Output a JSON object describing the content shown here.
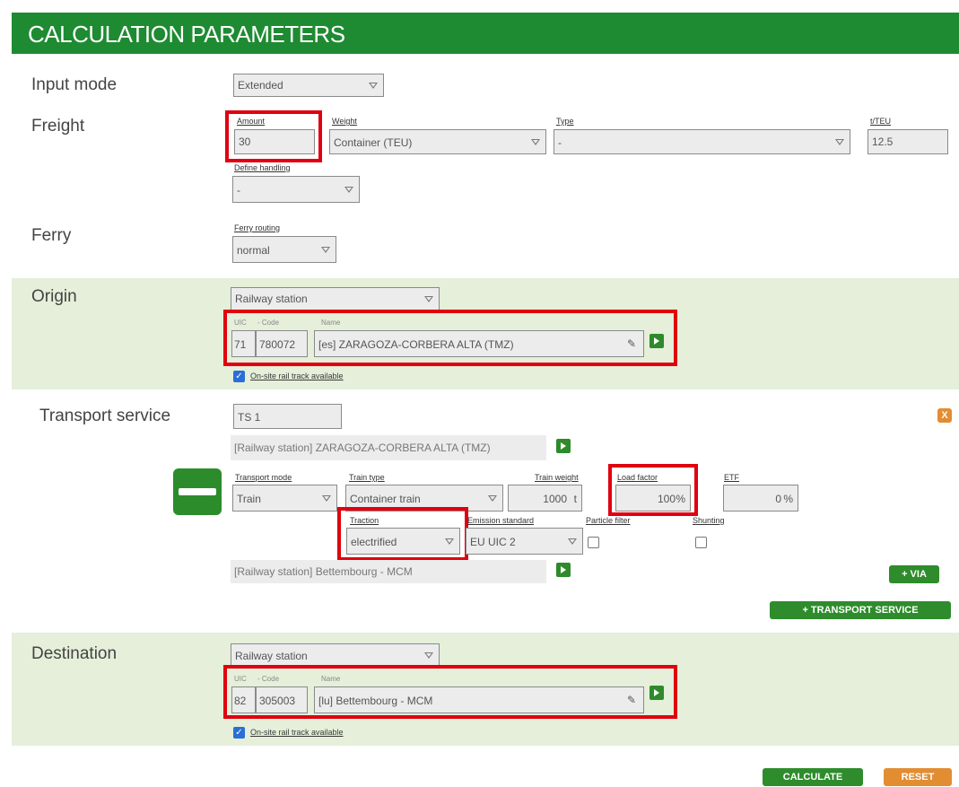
{
  "header": {
    "title": "CALCULATION PARAMETERS"
  },
  "input_mode": {
    "label": "Input mode",
    "value": "Extended"
  },
  "freight": {
    "label": "Freight",
    "amount_label": "Amount",
    "amount_value": "30",
    "weight_label": "Weight",
    "weight_value": "Container (TEU)",
    "type_label": "Type",
    "type_value": "-",
    "teu_label": "t/TEU",
    "teu_value": "12.5",
    "handling_label": "Define handling",
    "handling_value": "-"
  },
  "ferry": {
    "label": "Ferry",
    "routing_label": "Ferry routing",
    "routing_value": "normal"
  },
  "origin": {
    "label": "Origin",
    "type_value": "Railway station",
    "uic_label": "UIC",
    "code_label": "- Code",
    "name_label": "Name",
    "uic": "71",
    "code": "780072",
    "name": "[es] ZARAGOZA-CORBERA ALTA (TMZ)",
    "rail_track": "On-site rail track available"
  },
  "transport_service": {
    "label": "Transport service",
    "name_value": "TS 1",
    "from_station": "[Railway station] ZARAGOZA-CORBERA ALTA (TMZ)",
    "to_station": "[Railway station] Bettembourg - MCM",
    "mode_label": "Transport mode",
    "mode_value": "Train",
    "train_type_label": "Train type",
    "train_type_value": "Container train",
    "train_weight_label": "Train weight",
    "train_weight_value": "1000",
    "train_weight_unit": "t",
    "load_factor_label": "Load factor",
    "load_factor_value": "100",
    "load_factor_unit": "%",
    "etf_label": "ETF",
    "etf_value": "0",
    "etf_unit": "%",
    "traction_label": "Traction",
    "traction_value": "electrified",
    "emission_label": "Emission standard",
    "emission_value": "EU UIC 2",
    "particle_label": "Particle filter",
    "shunting_label": "Shunting",
    "via_button": "+ VIA",
    "add_service_button": "+ TRANSPORT SERVICE",
    "close_icon": "X"
  },
  "destination": {
    "label": "Destination",
    "type_value": "Railway station",
    "uic_label": "UIC",
    "code_label": "- Code",
    "name_label": "Name",
    "uic": "82",
    "code": "305003",
    "name": "[lu] Bettembourg - MCM",
    "rail_track": "On-site rail track available"
  },
  "actions": {
    "calculate": "CALCULATE",
    "reset": "RESET"
  },
  "colors": {
    "header_green": "#1e8b32",
    "band": "#e5efd9",
    "highlight_red": "#e0000f",
    "reset_orange": "#e38d33"
  }
}
